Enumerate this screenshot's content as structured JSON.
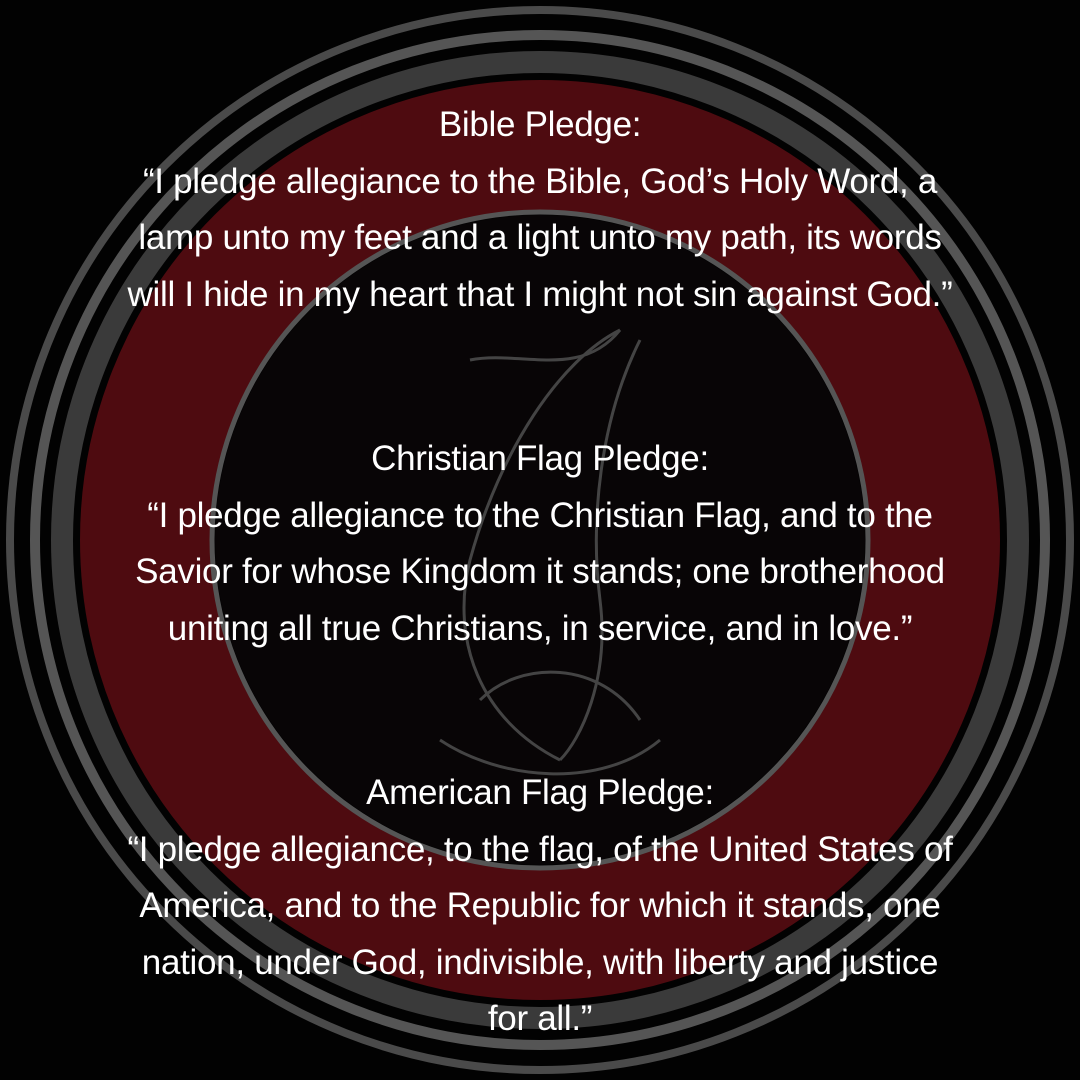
{
  "pledges": [
    {
      "title": "Bible Pledge:",
      "lines": [
        "“I pledge allegiance to the Bible, God’s Holy Word, a",
        "lamp unto my feet and a light unto my path, its words",
        "will I hide in my heart that I might not sin against God.”"
      ]
    },
    {
      "title": "Christian Flag Pledge:",
      "lines": [
        "“I pledge allegiance to the Christian Flag, and to the",
        "Savior for whose Kingdom it stands; one brotherhood",
        "uniting all true Christians, in service, and in love.”"
      ]
    },
    {
      "title": "American Flag Pledge:",
      "lines": [
        "“I pledge allegiance, to the flag, of the United States of",
        "America, and to the Republic for which it stands, one",
        "nation, under God, indivisible, with liberty and justice",
        "for all.”"
      ]
    }
  ],
  "colors": {
    "background": "#020202",
    "ring_red": "#5a0d12",
    "ring_gray": "#5c5c5c",
    "text": "#ffffff"
  }
}
